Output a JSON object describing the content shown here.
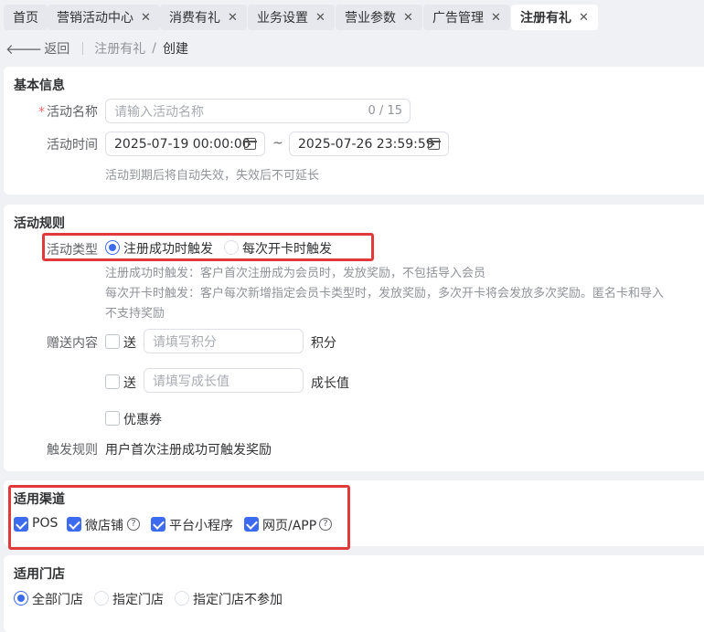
{
  "tabs": [
    {
      "label": "首页",
      "closable": false
    },
    {
      "label": "营销活动中心",
      "closable": true
    },
    {
      "label": "消费有礼",
      "closable": true
    },
    {
      "label": "业务设置",
      "closable": true
    },
    {
      "label": "营业参数",
      "closable": true
    },
    {
      "label": "广告管理",
      "closable": true
    },
    {
      "label": "注册有礼",
      "closable": true,
      "active": true
    }
  ],
  "breadcrumb": {
    "back": "返回",
    "parent": "注册有礼",
    "current": "创建"
  },
  "basic": {
    "title": "基本信息",
    "name_label": "活动名称",
    "name_placeholder": "请输入活动名称",
    "name_count": "0 / 15",
    "time_label": "活动时间",
    "start": "2025-07-19 00:00:00",
    "end": "2025-07-26 23:59:59",
    "tilde": "~",
    "time_hint": "活动到期后将自动失效，失效后不可延长"
  },
  "rules": {
    "title": "活动规则",
    "type_label": "活动类型",
    "type_options": [
      "注册成功时触发",
      "每次开卡时触发"
    ],
    "type_selected": 0,
    "hint1": "注册成功时触发：客户首次注册成为会员时，发放奖励，不包括导入会员",
    "hint2": "每次开卡时触发：客户每次新增指定会员卡类型时，发放奖励，多次开卡将会发放多次奖励。匿名卡和导入",
    "hint3": "不支持奖励",
    "gift_label": "赠送内容",
    "send": "送",
    "points_placeholder": "请填写积分",
    "points_unit": "积分",
    "growth_placeholder": "请填写成长值",
    "growth_unit": "成长值",
    "coupon": "优惠券",
    "trigger_label": "触发规则",
    "trigger_text": "用户首次注册成功可触发奖励"
  },
  "channels": {
    "title": "适用渠道",
    "items": [
      {
        "label": "POS",
        "checked": true,
        "help": false
      },
      {
        "label": "微店铺",
        "checked": true,
        "help": true
      },
      {
        "label": "平台小程序",
        "checked": true,
        "help": false
      },
      {
        "label": "网页/APP",
        "checked": true,
        "help": true
      }
    ]
  },
  "stores": {
    "title": "适用门店",
    "options": [
      "全部门店",
      "指定门店",
      "指定门店不参加"
    ],
    "selected": 0
  },
  "colors": {
    "primary": "#3c6bf0",
    "highlight": "#e03a3a",
    "required": "#f56c6c"
  }
}
